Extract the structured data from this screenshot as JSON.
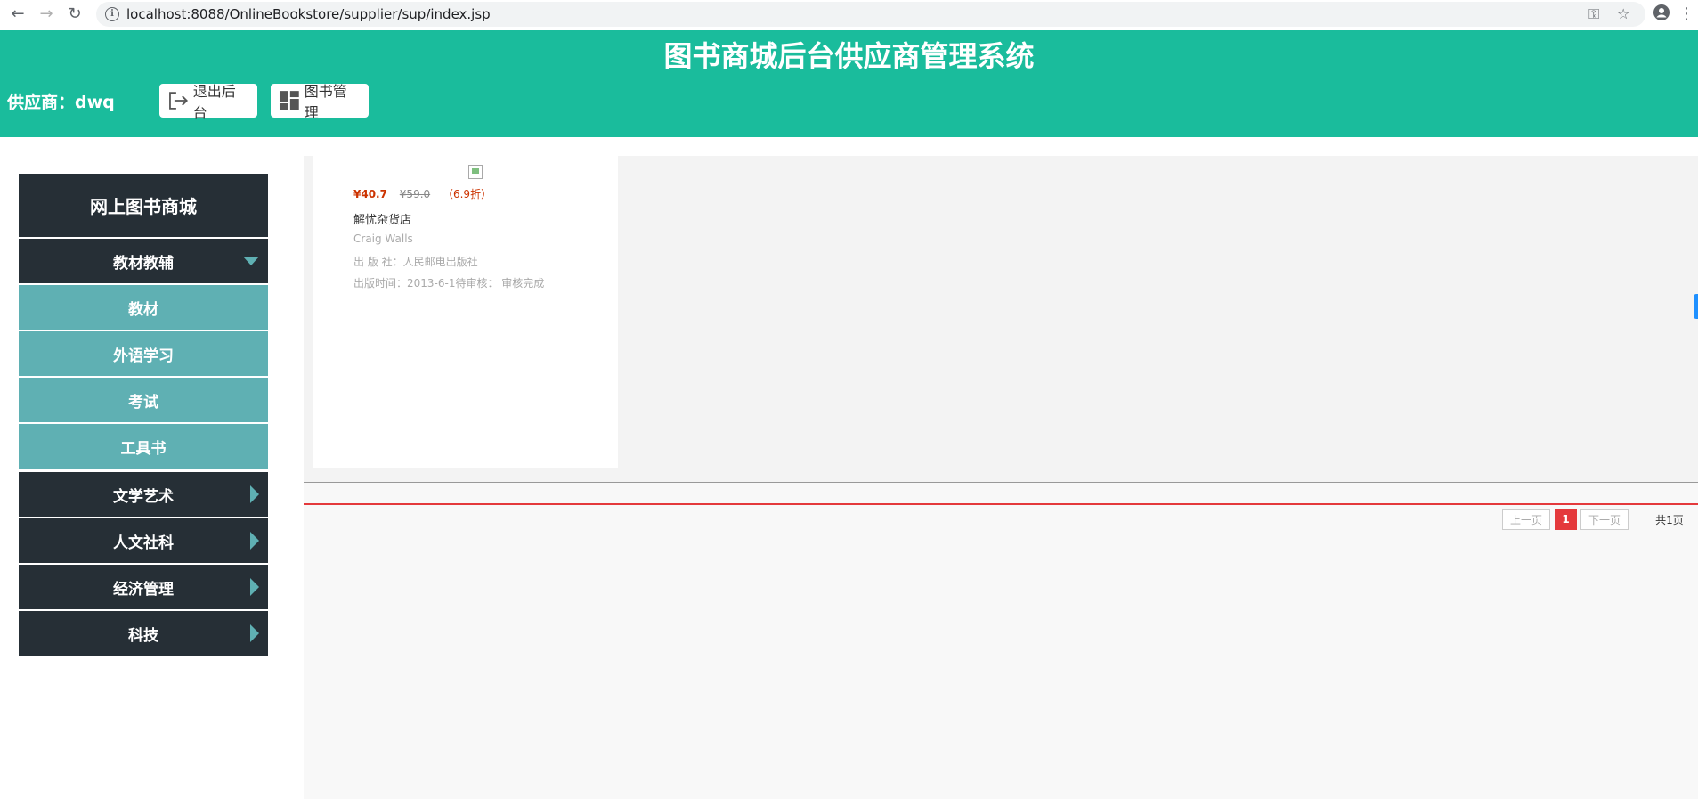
{
  "browser": {
    "url": "localhost:8088/OnlineBookstore/supplier/sup/index.jsp",
    "back_glyph": "←",
    "forward_glyph": "→",
    "reload_glyph": "↻",
    "info_glyph": "i",
    "key_glyph": "⚿",
    "star_glyph": "☆",
    "menu_glyph": "⋮"
  },
  "header": {
    "title": "图书商城后台供应商管理系统",
    "supplier_label": "供应商：dwq",
    "logout_label": "退出后台",
    "book_manage_label": "图书管理"
  },
  "sidebar": {
    "title": "网上图书商城",
    "categories": [
      {
        "label": "教材教辅",
        "expanded": true,
        "children": [
          "教材",
          "外语学习",
          "考试",
          "工具书"
        ]
      },
      {
        "label": "文学艺术",
        "expanded": false
      },
      {
        "label": "人文社科",
        "expanded": false
      },
      {
        "label": "经济管理",
        "expanded": false
      },
      {
        "label": "科技",
        "expanded": false
      }
    ]
  },
  "books": [
    {
      "price_now": "¥40.7",
      "price_old": "¥59.0",
      "discount": "（6.9折）",
      "title": "解忧杂货店",
      "author": "Craig Walls",
      "publisher_line": "出 版 社：人民邮电出版社",
      "date_status_line": "出版时间：2013-6-1待审核：  审核完成"
    }
  ],
  "pagination": {
    "prev_label": "上一页",
    "current_page": "1",
    "next_label": "下一页",
    "total_label": "共1页"
  },
  "colors": {
    "header_bg": "#1abc9c",
    "sidebar_dark": "#262f36",
    "sidebar_sub": "#5fb0b3",
    "accent_red": "#e4393c"
  }
}
